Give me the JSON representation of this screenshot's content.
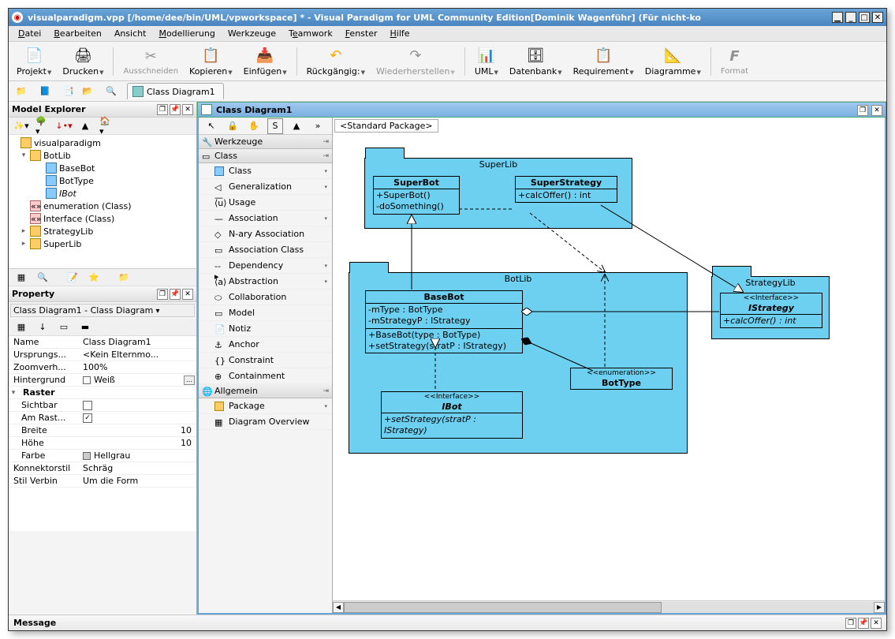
{
  "window": {
    "title": "visualparadigm.vpp [/home/dee/bin/UML/vpworkspace] * - Visual Paradigm for UML Community Edition[Dominik Wagenführ] (Für nicht-ko"
  },
  "menu": {
    "items": [
      "Datei",
      "Bearbeiten",
      "Ansicht",
      "Modellierung",
      "Werkzeuge",
      "Teamwork",
      "Fenster",
      "Hilfe"
    ]
  },
  "toolbar": {
    "projekt": "Projekt",
    "drucken": "Drucken",
    "ausschneiden": "Ausschneiden",
    "kopieren": "Kopieren",
    "einfuegen": "Einfügen",
    "rueckgaengig": "Rückgängig:",
    "wiederherstellen": "Wiederherstellen",
    "uml": "UML",
    "datenbank": "Datenbank",
    "requirement": "Requirement",
    "diagramme": "Diagramme",
    "format": "Format"
  },
  "tab": {
    "label": "Class Diagram1"
  },
  "explorer": {
    "title": "Model Explorer",
    "nodes": {
      "root": "visualparadigm",
      "botlib": "BotLib",
      "basebot": "BaseBot",
      "bottype": "BotType",
      "ibot": "IBot",
      "enum": "enumeration (Class)",
      "iface": "Interface (Class)",
      "strategylib": "StrategyLib",
      "superlib": "SuperLib"
    }
  },
  "property": {
    "title": "Property",
    "selector": "Class Diagram1  -  Class Diagram",
    "rows": {
      "name_l": "Name",
      "name_v": "Class Diagram1",
      "ursprung_l": "Ursprungs...",
      "ursprung_v": "<Kein Elternmo...",
      "zoom_l": "Zoomverh...",
      "zoom_v": "100%",
      "hinter_l": "Hintergrund",
      "hinter_v": "Weiß",
      "raster_l": "Raster",
      "sichtbar_l": "Sichtbar",
      "amrast_l": "Am Rast...",
      "breite_l": "Breite",
      "breite_v": "10",
      "hoehe_l": "Höhe",
      "hoehe_v": "10",
      "farbe_l": "Farbe",
      "farbe_v": "Hellgrau",
      "konn_l": "Konnektorstil",
      "konn_v": "Schräg",
      "stil_l": "Stil Verbin",
      "stil_v": "Um die Form"
    }
  },
  "diagram": {
    "title": "Class Diagram1",
    "crumb": "<Standard Package>",
    "toolbox": {
      "werkzeuge": "Werkzeuge",
      "class_hdr": "Class",
      "items": {
        "class": "Class",
        "generalization": "Generalization",
        "usage": "Usage",
        "association": "Association",
        "nary": "N-ary Association",
        "assocclass": "Association Class",
        "dependency": "Dependency",
        "abstraction": "Abstraction",
        "collaboration": "Collaboration",
        "model": "Model",
        "notiz": "Notiz",
        "anchor": "Anchor",
        "constraint": "Constraint",
        "containment": "Containment"
      },
      "allgemein": "Allgemein",
      "package": "Package",
      "overview": "Diagram Overview"
    },
    "uml": {
      "superlib": "SuperLib",
      "superbot": "SuperBot",
      "superbot_m1": "+SuperBot()",
      "superbot_m2": "-doSomething()",
      "superstrategy": "SuperStrategy",
      "superstrategy_m1": "+calcOffer() : int",
      "botlib": "BotLib",
      "basebot": "BaseBot",
      "basebot_a1": "-mType : BotType",
      "basebot_a2": "-mStrategyP : IStrategy",
      "basebot_m1": "+BaseBot(type : BotType)",
      "basebot_m2": "+setStrategy(stratP : IStrategy)",
      "iface_stereo": "<<Interface>>",
      "ibot": "IBot",
      "ibot_m1": "+setStrategy(stratP : IStrategy)",
      "enum_stereo": "<<enumeration>>",
      "bottype": "BotType",
      "strategylib": "StrategyLib",
      "istrategy": "IStrategy",
      "istrategy_m1": "+calcOffer() : int"
    }
  },
  "message": {
    "title": "Message"
  }
}
